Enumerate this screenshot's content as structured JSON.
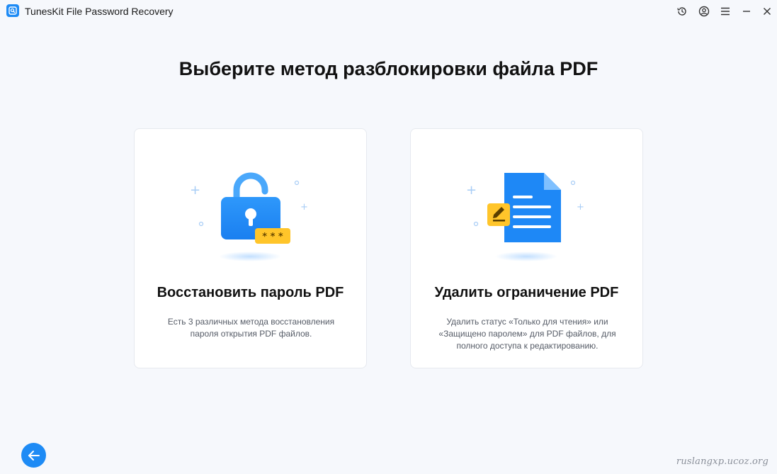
{
  "app": {
    "title": "TunesKit File Password Recovery",
    "icon": "app-logo-icon",
    "accent_color": "#1e8bf5"
  },
  "titlebar": {
    "buttons": [
      {
        "name": "history-icon"
      },
      {
        "name": "account-icon"
      },
      {
        "name": "menu-icon"
      },
      {
        "name": "minimize-icon"
      },
      {
        "name": "close-icon"
      }
    ]
  },
  "main": {
    "title": "Выберите метод разблокировки файла PDF",
    "cards": [
      {
        "icon": "unlock-padlock-icon",
        "title": "Восстановить пароль PDF",
        "description": "Есть 3 различных метода восстановления пароля открытия PDF файлов.",
        "badge_text": "* * *"
      },
      {
        "icon": "document-edit-icon",
        "title": "Удалить ограничение PDF",
        "description": "Удалить статус «Только для чтения» или «Защищено паролем» для PDF файлов, для полного доступа к редактированию."
      }
    ]
  },
  "footer": {
    "back_icon": "arrow-left-icon",
    "watermark": "ruslangxp.ucoz.org"
  }
}
